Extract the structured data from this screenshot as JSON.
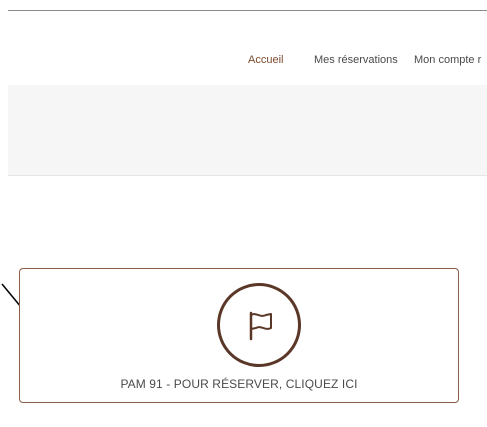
{
  "nav": {
    "items": [
      {
        "label": "Accueil",
        "active": true
      },
      {
        "label": "Mes réservations",
        "active": false
      },
      {
        "label": "Mon compte r",
        "active": false
      }
    ]
  },
  "card": {
    "label": "PAM 91 - POUR RÉSERVER, CLIQUEZ ICI",
    "icon": "flag-icon"
  },
  "colors": {
    "accent": "#7a4a2f",
    "card_border": "#8b5e49",
    "icon_stroke": "#5a3726",
    "band_bg": "#f7f6f6",
    "text": "#4a4a4a"
  }
}
